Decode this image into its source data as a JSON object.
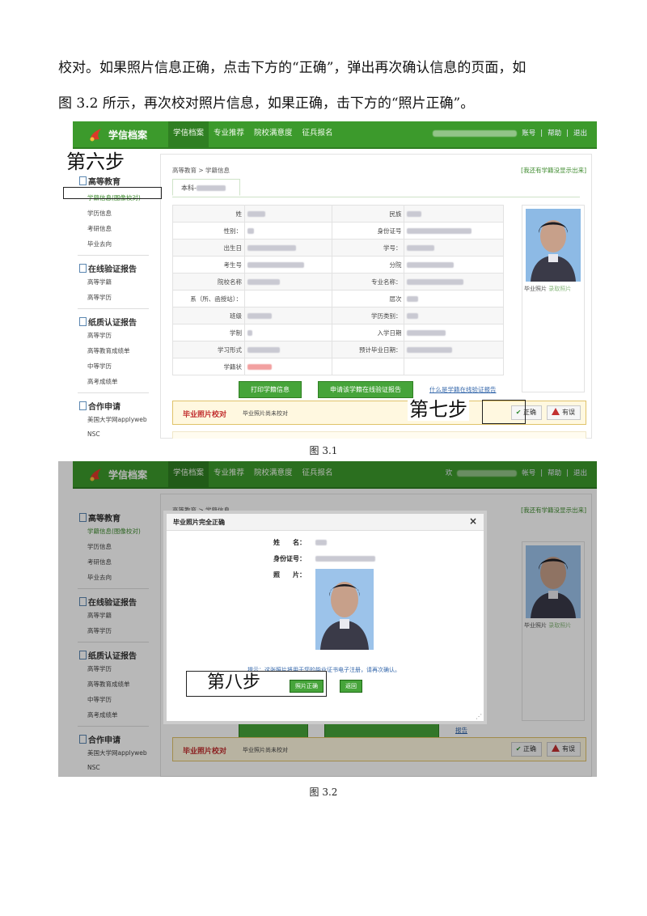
{
  "paragraph": {
    "line1": "校对。如果照片信息正确，点击下方的“正确”，弹出再次确认信息的页面，如",
    "line2": "图 3.2 所示，再次校对照片信息，如果正确，击下方的“照片正确”。"
  },
  "captions": {
    "fig1": "图 3.1",
    "fig2": "图 3.2"
  },
  "site": {
    "logo_text": "学信档案",
    "nav": [
      "学信档案",
      "专业推荐",
      "院校满意度",
      "征兵报名"
    ],
    "topright_1": [
      "账号",
      "帮助",
      "退出"
    ],
    "topright_2": [
      "欢",
      "帐号",
      "帮助",
      "退出"
    ]
  },
  "sidebar": {
    "sec1_title": "高等教育",
    "sec1_items": [
      "学籍信息(图像校对)",
      "学历信息",
      "考研信息",
      "毕业去向"
    ],
    "sec2_title": "在线验证报告",
    "sec2_items": [
      "高等学籍",
      "高等学历"
    ],
    "sec3_title": "纸质认证报告",
    "sec3_items": [
      "高等学历",
      "高等教育成绩单",
      "中等学历",
      "高考成绩单"
    ],
    "sec4_title": "合作申请",
    "sec4_items": [
      "美国大学网applyweb",
      "NSC"
    ]
  },
  "main": {
    "breadcrumb": "高等教育 > 学籍信息",
    "breadcrumb_right": "[我还有学籍没显示出来]",
    "tab": "本科-",
    "left_labels": [
      "姓",
      "性别：",
      "出生日",
      "考生号",
      "院校名称",
      "系（所、函授站）：",
      "班级",
      "学制",
      "学习形式",
      "学籍状"
    ],
    "right_labels": [
      "民族",
      "身份证号",
      "学号：",
      "分院",
      "专业名称：",
      "层次",
      "学历类别：",
      "入学日期",
      "预计毕业日期："
    ],
    "photo_caption": "毕业照片",
    "photo_caption_link": "录取照片",
    "btn_print": "打印学籍信息",
    "btn_apply": "申请该学籍在线验证报告",
    "link_what": "什么是学籍在线验证报告",
    "verify_title": "毕业照片校对",
    "verify_status": "毕业照片尚未校对",
    "btn_correct": "正确",
    "btn_error": "有误"
  },
  "steps": {
    "six": "第六步",
    "seven": "第七步",
    "eight": "第八步"
  },
  "modal": {
    "title": "毕业照片完全正确",
    "close": "×",
    "name_label": "姓　　名：",
    "id_label": "身份证号：",
    "photo_label": "照　　片：",
    "hint": "提示：这张照片将用于您的毕业证书电子注册，请再次确认。",
    "btn_confirm": "照片正确",
    "btn_back": "返回"
  },
  "fig2_partial_link": "报告",
  "colors": {
    "brand_green": "#3c9a2c",
    "alert_red": "#c23030",
    "link_blue": "#3366aa"
  }
}
